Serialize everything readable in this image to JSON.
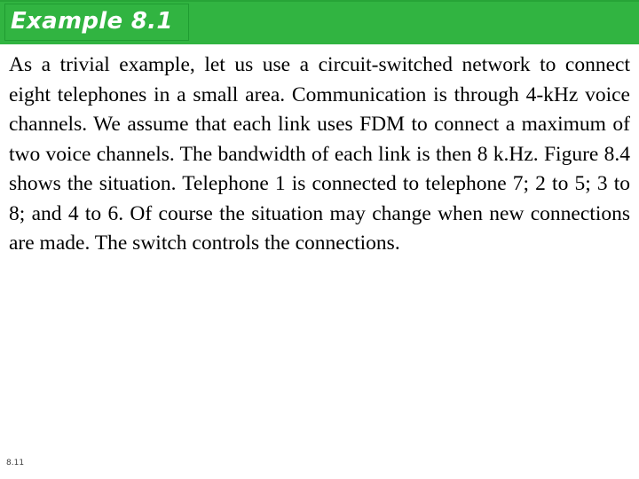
{
  "slide": {
    "title": "Example 8.1",
    "footer_number": "8.11",
    "body_text": "As a trivial example, let us use a circuit-switched network to connect eight telephones in a small area. Communication is through 4-kHz voice channels. We assume that each link uses FDM to connect a maximum of two voice channels. The bandwidth of each link is then 8 k.Hz. Figure 8.4 shows the situation. Telephone 1 is connected to telephone 7; 2 to 5; 3 to 8; and 4 to 6. Of course the situation may change when new connections are made. The switch controls the connections.",
    "colors": {
      "header_green": "#31b441",
      "header_top_border_green": "#27a437",
      "title_box_border_green": "#1f9c31",
      "title_text": "#ffffff",
      "body_text": "#000000",
      "footer_text": "#3b3b3b",
      "background": "#ffffff"
    }
  }
}
